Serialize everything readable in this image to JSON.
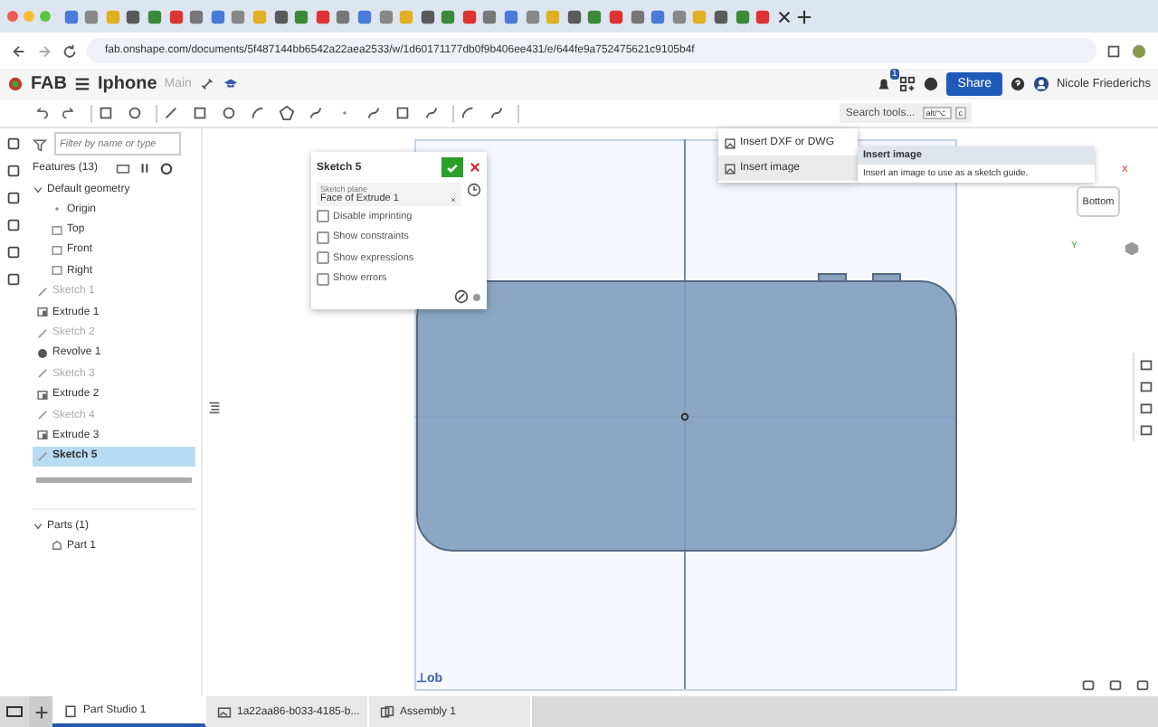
{
  "browser": {
    "url": "fab.onshape.com/documents/5f487144bb6542a22aea2533/w/1d60171177db0f9b406ee431/e/644fe9a752475621c9105b4f"
  },
  "header": {
    "logo": "FAB",
    "document": "Iphone",
    "branch": "Main",
    "notifications": "1",
    "share": "Share",
    "user": "Nicole Friederichs"
  },
  "toolbar": {
    "search": {
      "placeholder": "Search tools...",
      "shortcut": "alt/⌥",
      "key": "c"
    }
  },
  "features": {
    "filter": {
      "placeholder": "Filter by name or type"
    },
    "title": "Features (13)",
    "groups": [
      {
        "label": "Default geometry",
        "expanded": true,
        "children": [
          {
            "label": "Origin",
            "kind": "origin",
            "visible": true,
            "selected": false
          },
          {
            "label": "Top",
            "kind": "plane",
            "visible": true,
            "selected": false
          },
          {
            "label": "Front",
            "kind": "plane",
            "visible": true,
            "selected": false
          },
          {
            "label": "Right",
            "kind": "plane",
            "visible": true,
            "selected": false
          }
        ]
      }
    ],
    "items": [
      {
        "label": "Sketch 1",
        "kind": "sketch",
        "visible": false,
        "selected": false
      },
      {
        "label": "Extrude 1",
        "kind": "extrude",
        "visible": true,
        "selected": false
      },
      {
        "label": "Sketch 2",
        "kind": "sketch",
        "visible": false,
        "selected": false
      },
      {
        "label": "Revolve 1",
        "kind": "revolve",
        "visible": true,
        "selected": false
      },
      {
        "label": "Sketch 3",
        "kind": "sketch",
        "visible": false,
        "selected": false
      },
      {
        "label": "Extrude 2",
        "kind": "extrude",
        "visible": true,
        "selected": false
      },
      {
        "label": "Sketch 4",
        "kind": "sketch",
        "visible": false,
        "selected": false
      },
      {
        "label": "Extrude 3",
        "kind": "extrude",
        "visible": true,
        "selected": false
      },
      {
        "label": "Sketch 5",
        "kind": "sketch",
        "visible": true,
        "selected": true
      }
    ],
    "parts": {
      "label": "Parts (1)",
      "expanded": true,
      "children": [
        {
          "label": "Part 1"
        }
      ]
    }
  },
  "sketch_dialog": {
    "title": "Sketch 5",
    "plane_label": "Sketch plane",
    "plane_value": "Face of Extrude 1",
    "options": [
      {
        "label": "Disable imprinting",
        "checked": false
      },
      {
        "label": "Show constraints",
        "checked": false
      },
      {
        "label": "Show expressions",
        "checked": false
      },
      {
        "label": "Show errors",
        "checked": false
      }
    ]
  },
  "insert_menu": {
    "items": [
      {
        "label": "Insert DXF or DWG",
        "selected": false
      },
      {
        "label": "Insert image",
        "selected": true
      }
    ]
  },
  "tooltip": {
    "title": "Insert image",
    "text": "Insert an image to use as a sketch guide."
  },
  "view_cube": {
    "face": "Bottom",
    "x_axis": "X",
    "y_axis": "Y"
  },
  "canvas": {
    "plane_label": "⊥ob"
  },
  "tabs": [
    {
      "label": "Part Studio 1",
      "kind": "partstudio",
      "selected": true
    },
    {
      "label": "1a22aa86-b033-4185-b...",
      "kind": "image",
      "selected": false
    },
    {
      "label": "Assembly 1",
      "kind": "assembly",
      "selected": false
    }
  ]
}
